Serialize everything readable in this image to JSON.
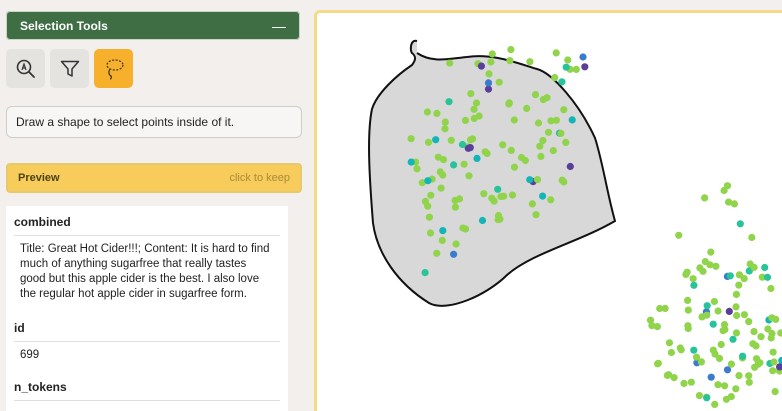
{
  "sidebar": {
    "title": "Selection Tools",
    "collapse_symbol": "—",
    "tools": [
      {
        "icon": "zoom-select-icon",
        "active": false
      },
      {
        "icon": "filter-icon",
        "active": false
      },
      {
        "icon": "lasso-icon",
        "active": true
      }
    ],
    "hint": "Draw a shape to select points inside of it.",
    "preview": {
      "label": "Preview",
      "action": "click to keep"
    },
    "fields": [
      {
        "name": "combined",
        "value": "Title: Great Hot Cider!!!; Content: It is hard to find much of anything sugarfree that really tastes good but this apple cider is the best. I also love the regular hot apple cider in sugarfree form."
      },
      {
        "name": "id",
        "value": "699"
      },
      {
        "name": "n_tokens",
        "value": ""
      }
    ]
  },
  "colors": {
    "header_green": "#3f6e45",
    "active_tool": "#f6b02c",
    "preview_yellow": "#f7cc5b",
    "lasso_fill": "#d8d8d8",
    "point_palette": [
      "#8fd44a",
      "#27c49a",
      "#13b5b7",
      "#3a7bd0",
      "#5b3d9a"
    ]
  }
}
